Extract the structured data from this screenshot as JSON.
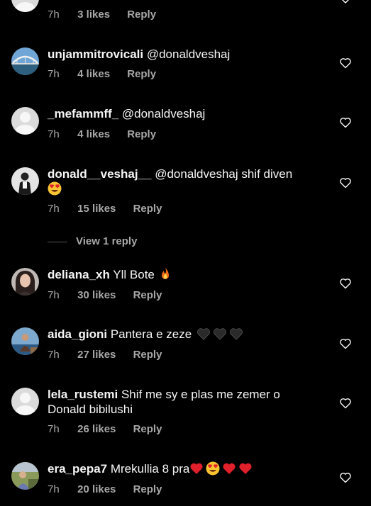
{
  "comments": [
    {
      "username": "",
      "text": "",
      "time": "7h",
      "likes": "3 likes",
      "reply": "Reply",
      "avatar": "placeholder-avatar"
    },
    {
      "username": "unjammitrovicali",
      "text": "@donaldveshaj",
      "time": "7h",
      "likes": "4 likes",
      "reply": "Reply",
      "avatar": "bridge-photo-avatar"
    },
    {
      "username": "_mefammff_",
      "text": "@donaldveshaj",
      "time": "7h",
      "likes": "4 likes",
      "reply": "Reply",
      "avatar": "placeholder-avatar"
    },
    {
      "username": "donald__veshaj__",
      "text": "@donaldveshaj shif diven",
      "time": "7h",
      "likes": "15 likes",
      "reply": "Reply",
      "avatar": "person-photo-avatar",
      "emoji": "heart-eyes-emoji"
    },
    {
      "username": "deliana_xh",
      "text": "Yll Bote",
      "time": "7h",
      "likes": "30 likes",
      "reply": "Reply",
      "avatar": "woman-photo-avatar",
      "emoji": "fire-emoji"
    },
    {
      "username": "aida_gioni",
      "text": "Pantera e zeze",
      "time": "7h",
      "likes": "27 likes",
      "reply": "Reply",
      "avatar": "sea-photo-avatar",
      "emoji": "black-hearts-emoji"
    },
    {
      "username": "lela_rustemi",
      "text": "Shif me sy e plas me zemer o Donald bibilushi",
      "time": "7h",
      "likes": "26 likes",
      "reply": "Reply",
      "avatar": "placeholder-avatar"
    },
    {
      "username": "era_pepa7",
      "text": "Mrekullia 8 pra",
      "time": "7h",
      "likes": "20 likes",
      "reply": "Reply",
      "avatar": "outdoor-photo-avatar",
      "emoji": "hearts-emoji"
    }
  ],
  "view_replies": "View 1 reply",
  "colors": {
    "background": "#000000",
    "text": "#f5f5f5",
    "meta": "#a8a8a8",
    "heart_red": "#e0202a"
  }
}
